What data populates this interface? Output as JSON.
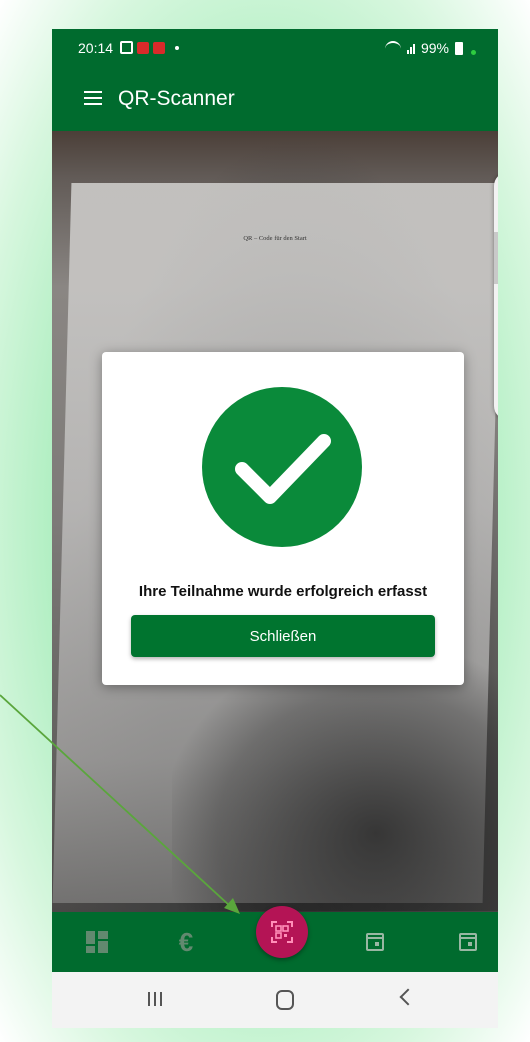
{
  "status_bar": {
    "time": "20:14",
    "battery": "99%"
  },
  "app_bar": {
    "title": "QR-Scanner",
    "menu_icon": "hamburger-menu-icon"
  },
  "camera_view": {
    "document_text": "QR – Code für den Start"
  },
  "dialog": {
    "icon": "check-circle-icon",
    "message": "Ihre Teilnahme wurde erfolgreich erfasst",
    "close_button_label": "Schließen"
  },
  "bottom_nav": {
    "items": [
      {
        "icon": "dashboard-icon"
      },
      {
        "icon": "euro-icon",
        "glyph": "€"
      },
      {
        "icon": "qr-scan-icon",
        "active": true
      },
      {
        "icon": "calendar-icon"
      },
      {
        "icon": "calendar-icon"
      }
    ]
  },
  "colors": {
    "primary_green": "#006b2e",
    "success_green": "#0a8a3a",
    "fab_magenta": "#b41455",
    "annotation_arrow": "#5aa63c"
  }
}
